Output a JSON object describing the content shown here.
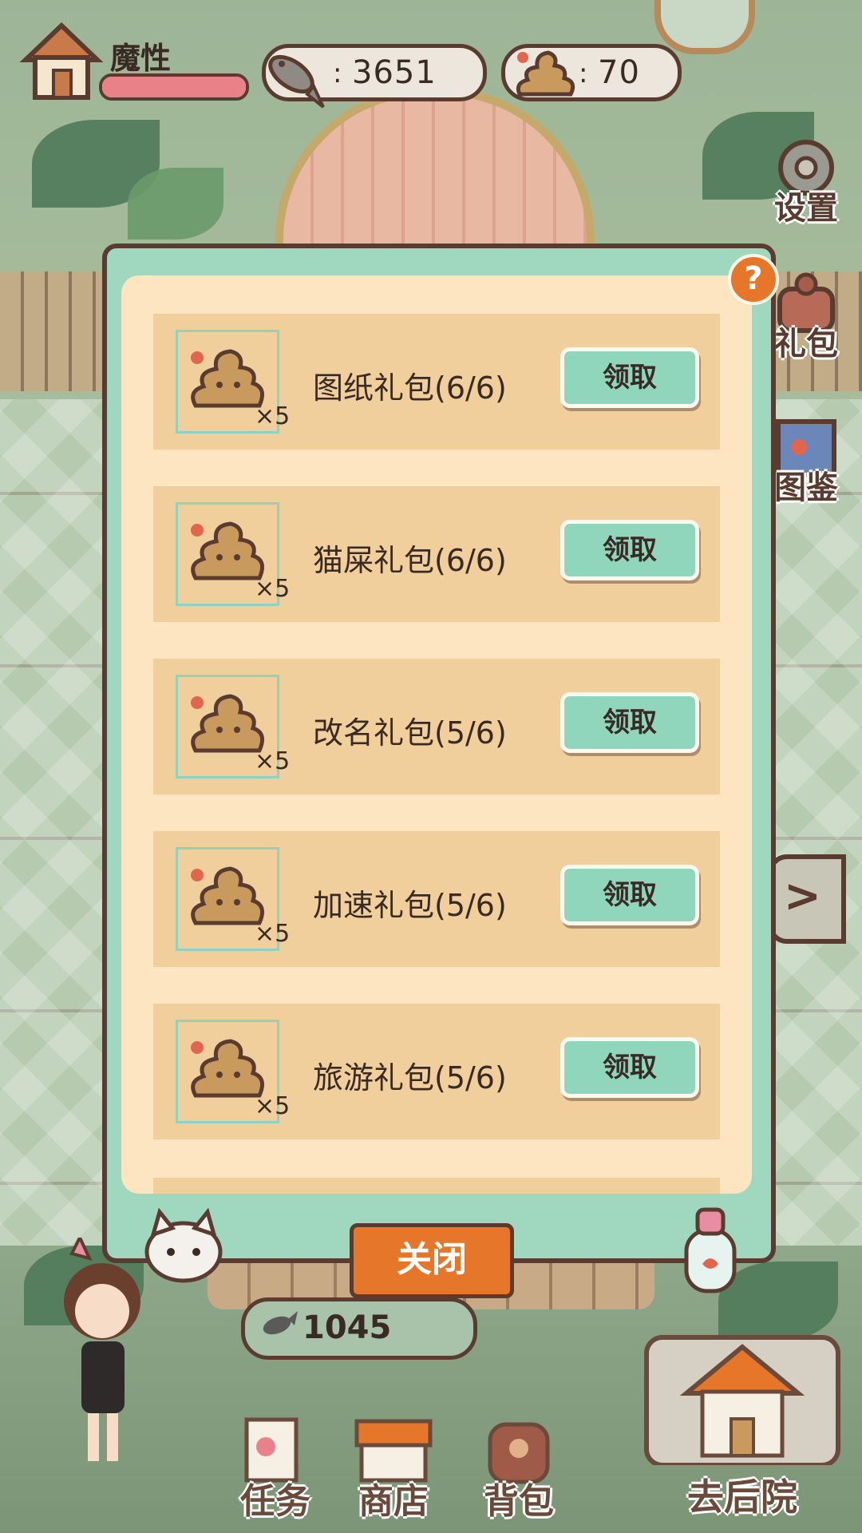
{
  "player": {
    "name": "魔性",
    "hp_fraction": 1.0
  },
  "currencies": [
    {
      "icon": "fish-icon",
      "value": "3651"
    },
    {
      "icon": "poop-icon",
      "value": "70"
    }
  ],
  "side_menu": [
    {
      "label": "设置",
      "icon": "gear-icon"
    },
    {
      "label": "礼包",
      "icon": "gift-icon"
    },
    {
      "label": "图鉴",
      "icon": "book-icon"
    }
  ],
  "side_arrow": ">",
  "modal": {
    "help": "?",
    "rows": [
      {
        "title": "图纸礼包(6/6)",
        "qty": "×5",
        "button": "领取"
      },
      {
        "title": "猫屎礼包(6/6)",
        "qty": "×5",
        "button": "领取"
      },
      {
        "title": "改名礼包(5/6)",
        "qty": "×5",
        "button": "领取"
      },
      {
        "title": "加速礼包(5/6)",
        "qty": "×5",
        "button": "领取"
      },
      {
        "title": "旅游礼包(5/6)",
        "qty": "×5",
        "button": "领取"
      }
    ],
    "close": "关闭"
  },
  "fish_balance": "1045",
  "bottom_nav": [
    {
      "label": "任务",
      "icon": "task-icon"
    },
    {
      "label": "商店",
      "icon": "shop-icon"
    },
    {
      "label": "背包",
      "icon": "backpack-icon"
    }
  ],
  "backyard_label": "去后院",
  "colors": {
    "accent": "#e6762a",
    "mint": "#8fd6bd",
    "outline": "#5a3b30",
    "panel": "#fce5c0"
  }
}
